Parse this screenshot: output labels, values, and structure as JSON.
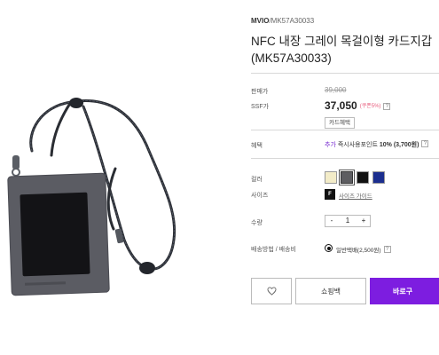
{
  "product": {
    "brand": "MVIO",
    "code": "/MK57A30033",
    "title_line1": "NFC 내장 그레이 목걸이형 카드지갑",
    "title_line2": "(MK57A30033)"
  },
  "pricing": {
    "list_label": "판매가",
    "list_price": "39,000",
    "ssf_label": "SSF가",
    "ssf_price": "37,050",
    "discount_text": "(쿠폰5%)",
    "info_glyph": "?",
    "card_benefit_button": "카드혜택"
  },
  "benefits": {
    "label": "혜택",
    "plus_text": "추가",
    "desc_text": " 즉시사용포인트 ",
    "percent": "10%",
    "amount": " (3,700원)",
    "info_glyph": "?"
  },
  "options": {
    "color_label": "컬러",
    "colors": [
      {
        "name": "cream",
        "hex": "#f3ecc8"
      },
      {
        "name": "gray",
        "hex": "#5d5d61"
      },
      {
        "name": "black",
        "hex": "#111111"
      },
      {
        "name": "navy",
        "hex": "#1b2e8e"
      }
    ],
    "selected_color_index": 1,
    "size_label": "사이즈",
    "size_value": "F",
    "size_guide": "사이즈 가이드",
    "qty_label": "수량",
    "qty_minus": "-",
    "qty_value": "1",
    "qty_plus": "+"
  },
  "shipping": {
    "label": "배송방법 / 배송비",
    "option_text": "일반택배(2,500원)",
    "info_glyph": "?"
  },
  "actions": {
    "wishlist_icon": "heart-icon",
    "shopping_bag": "쇼핑백",
    "buy_now": "바로구"
  },
  "accent_color": "#7d1de0"
}
